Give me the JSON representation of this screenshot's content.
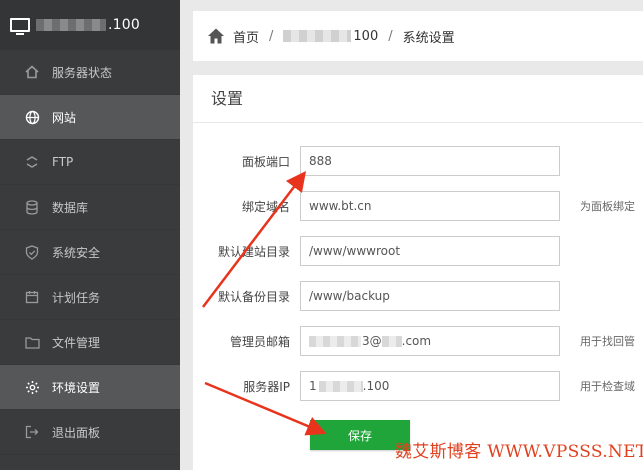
{
  "brand": {
    "ip_suffix": ".100"
  },
  "sidebar": {
    "items": [
      {
        "label": "服务器状态",
        "icon": "home-icon"
      },
      {
        "label": "网站",
        "icon": "globe-icon",
        "active": true
      },
      {
        "label": "FTP",
        "icon": "ftp-icon"
      },
      {
        "label": "数据库",
        "icon": "database-icon"
      },
      {
        "label": "系统安全",
        "icon": "shield-icon"
      },
      {
        "label": "计划任务",
        "icon": "calendar-icon"
      },
      {
        "label": "文件管理",
        "icon": "folder-icon"
      },
      {
        "label": "环境设置",
        "icon": "gear-icon",
        "active": true
      },
      {
        "label": "退出面板",
        "icon": "logout-icon"
      }
    ]
  },
  "breadcrumb": {
    "home": "首页",
    "sep": "/",
    "ip_suffix": "100",
    "current": "系统设置"
  },
  "panel": {
    "title": "设置",
    "fields": [
      {
        "label": "面板端口",
        "value": "888",
        "hint": ""
      },
      {
        "label": "绑定域名",
        "value": "www.bt.cn",
        "hint": "为面板绑定"
      },
      {
        "label": "默认建站目录",
        "value": "/www/wwwroot",
        "hint": ""
      },
      {
        "label": "默认备份目录",
        "value": "/www/backup",
        "hint": ""
      },
      {
        "label": "管理员邮箱",
        "value_mid": "3@",
        "value_end": ".com",
        "hint": "用于找回管"
      },
      {
        "label": "服务器IP",
        "value_start": "1",
        "value_end": ".100",
        "hint": "用于检查域"
      }
    ],
    "save_label": "保存"
  },
  "watermark": "魏艾斯博客 WWW.VPSSS.NET",
  "colors": {
    "sidebar_bg": "#393b3d",
    "accent_green": "#20a53a",
    "arrow_red": "#e8341c"
  }
}
